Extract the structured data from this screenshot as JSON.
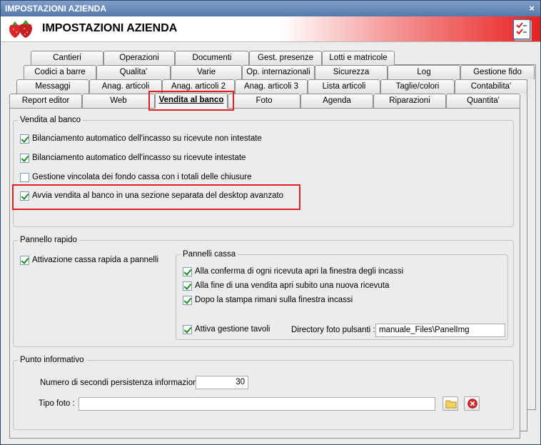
{
  "window": {
    "title": "IMPOSTAZIONI AZIENDA",
    "close_glyph": "×"
  },
  "header": {
    "title": "IMPOSTAZIONI AZIENDA",
    "logo_icon": "strawberry-icon",
    "right_icon": "checklist-icon"
  },
  "tabs": {
    "row1": [
      "Cantieri",
      "Operazioni",
      "Documenti",
      "Gest. presenze",
      "Lotti e matricole"
    ],
    "row2": [
      "Codici a barre",
      "Qualita'",
      "Varie",
      "Op. internazionali",
      "Sicurezza",
      "Log",
      "Gestione fido"
    ],
    "row3": [
      "Messaggi",
      "Anag. articoli",
      "Anag. articoli 2",
      "Anag. articoli 3",
      "Lista articoli",
      "Taglie/colori",
      "Contabilita'"
    ],
    "row4": [
      "Report editor",
      "Web",
      "Vendita al banco",
      "Foto",
      "Agenda",
      "Riparazioni",
      "Quantita'"
    ],
    "active": "Vendita al banco"
  },
  "vendita": {
    "legend": "Vendita al banco",
    "options": [
      {
        "label": "Bilanciamento automatico dell'incasso su ricevute non intestate",
        "checked": true
      },
      {
        "label": "Bilanciamento automatico dell'incasso su ricevute intestate",
        "checked": true
      },
      {
        "label": "Gestione vincolata dei fondo cassa con i totali delle chiusure",
        "checked": false
      },
      {
        "label": "Avvia vendita al banco in una sezione separata del desktop avanzato",
        "checked": true
      }
    ]
  },
  "pannello": {
    "legend": "Pannello rapido",
    "attivazione": {
      "label": "Attivazione cassa rapida a pannelli",
      "checked": true
    },
    "cassa": {
      "legend": "Pannelli cassa",
      "options": [
        {
          "label": "Alla conferma di ogni ricevuta apri la finestra degli incassi",
          "checked": true
        },
        {
          "label": "Alla fine di una vendita apri subito una nuova ricevuta",
          "checked": true
        },
        {
          "label": "Dopo la stampa rimani sulla finestra incassi",
          "checked": true
        },
        {
          "label": "Attiva gestione tavoli",
          "checked": true
        }
      ],
      "directory_label": "Directory foto pulsanti :",
      "directory_value": "manuale_Files\\PanelImg"
    }
  },
  "punto": {
    "legend": "Punto informativo",
    "secondi_label": "Numero di secondi persistenza informazioni :",
    "secondi_value": "30",
    "tipo_foto_label": "Tipo foto :",
    "tipo_foto_value": "",
    "folder_icon": "folder-icon",
    "delete_icon": "delete-icon"
  },
  "colors": {
    "highlight": "#e02020",
    "check": "#1a8f1a",
    "title_bar": "#5479aa"
  }
}
